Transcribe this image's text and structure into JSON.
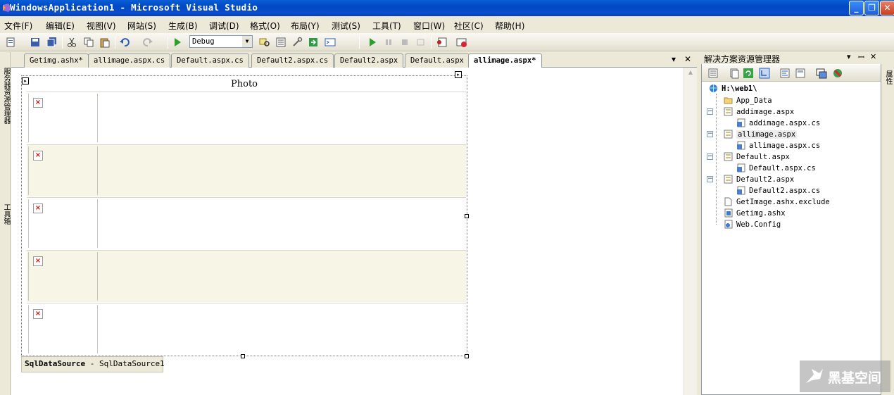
{
  "window": {
    "title": "WindowsApplication1 - Microsoft Visual Studio"
  },
  "menu": [
    "文件(F)",
    "编辑(E)",
    "视图(V)",
    "网站(S)",
    "生成(B)",
    "调试(D)",
    "格式(O)",
    "布局(Y)",
    "测试(S)",
    "工具(T)",
    "窗口(W)",
    "社区(C)",
    "帮助(H)"
  ],
  "toolbar": {
    "config_value": "Debug"
  },
  "left_rail": {
    "label1": "服务器资源管理器",
    "label2": "工具箱"
  },
  "right_rail": {
    "label": "属性"
  },
  "doc_tabs": [
    "Getimg.ashx*",
    "allimage.aspx.cs",
    "Default.aspx.cs",
    "Default2.aspx.cs",
    "Default2.aspx",
    "Default.aspx",
    "allimage.aspx*"
  ],
  "active_tab_index": 6,
  "gridview": {
    "header": "Photo",
    "row_count": 5
  },
  "datasource": {
    "type": "SqlDataSource",
    "name": "SqlDataSource1"
  },
  "solution_explorer": {
    "title": "解决方案资源管理器",
    "root": "H:\\web1\\",
    "items": [
      {
        "label": "App_Data",
        "kind": "folder"
      },
      {
        "label": "addimage.aspx",
        "kind": "page"
      },
      {
        "label": "addimage.aspx.cs",
        "kind": "code"
      },
      {
        "label": "allimage.aspx",
        "kind": "page",
        "selected": true
      },
      {
        "label": "allimage.aspx.cs",
        "kind": "code"
      },
      {
        "label": "Default.aspx",
        "kind": "page"
      },
      {
        "label": "Default.aspx.cs",
        "kind": "code"
      },
      {
        "label": "Default2.aspx",
        "kind": "page"
      },
      {
        "label": "Default2.aspx.cs",
        "kind": "code"
      },
      {
        "label": "GetImage.ashx.exclude",
        "kind": "file"
      },
      {
        "label": "Getimg.ashx",
        "kind": "handler"
      },
      {
        "label": "Web.Config",
        "kind": "config"
      }
    ]
  },
  "watermark": {
    "text": "黑基空间"
  },
  "colors": {
    "titlebar": "#0a4ed0",
    "alt_row": "#f7f6e6",
    "chrome": "#ece9d8"
  }
}
